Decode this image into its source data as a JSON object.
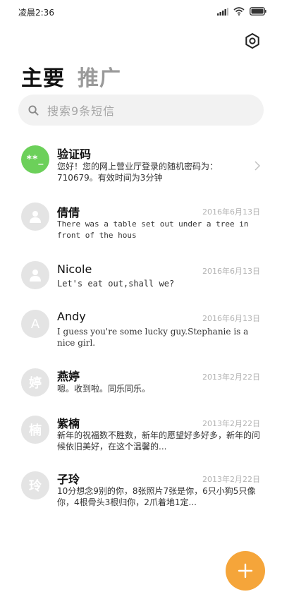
{
  "status_bar": {
    "time": "凌晨2:36"
  },
  "header": {
    "tabs": [
      {
        "label": "主要",
        "active": true
      },
      {
        "label": "推广",
        "active": false
      }
    ]
  },
  "search": {
    "placeholder": "搜索9条短信"
  },
  "messages": [
    {
      "sender": "验证码",
      "avatar_text": "**_",
      "avatar_color": "#6cd05a",
      "date": "",
      "preview": "您好！您的网上营业厅登录的随机密码为：710679。有效时间为3分钟",
      "has_chevron": true
    },
    {
      "sender": "倩倩",
      "avatar_text": "",
      "date": "2016年6月13日",
      "preview": "There was a table set out under a tree in front of the hous"
    },
    {
      "sender": "Nicole",
      "avatar_text": "",
      "date": "2016年6月13日",
      "preview": "Let's eat out,shall we?"
    },
    {
      "sender": "Andy",
      "avatar_text": "A",
      "date": "2016年6月13日",
      "preview": "I guess you're some lucky guy.Stephanie is a nice girl."
    },
    {
      "sender": "燕婷",
      "avatar_text": "婷",
      "date": "2013年2月22日",
      "preview": "嗯。收到啦。同乐同乐。"
    },
    {
      "sender": "紫楠",
      "avatar_text": "楠",
      "date": "2013年2月22日",
      "preview": "新年的祝福数不胜数，新年的愿望好多好多，新年的问候依旧美好，在这个温馨的..."
    },
    {
      "sender": "子玲",
      "avatar_text": "玲",
      "date": "2013年2月22日",
      "preview": "10分想念9别的你，8张照片7张是你，6只小狗5只像你，4根骨头3根归你，2爪着地1定..."
    }
  ],
  "icons": {
    "settings": "gear-icon",
    "search": "search-icon",
    "fab": "plus-icon",
    "signal": "signal-icon",
    "wifi": "wifi-icon",
    "battery": "battery-icon",
    "person": "person-icon",
    "chevron": "chevron-right-icon"
  },
  "colors": {
    "accent": "#f5a53a",
    "verified_avatar": "#6cd05a",
    "inactive_tab": "#9a9a9a"
  }
}
